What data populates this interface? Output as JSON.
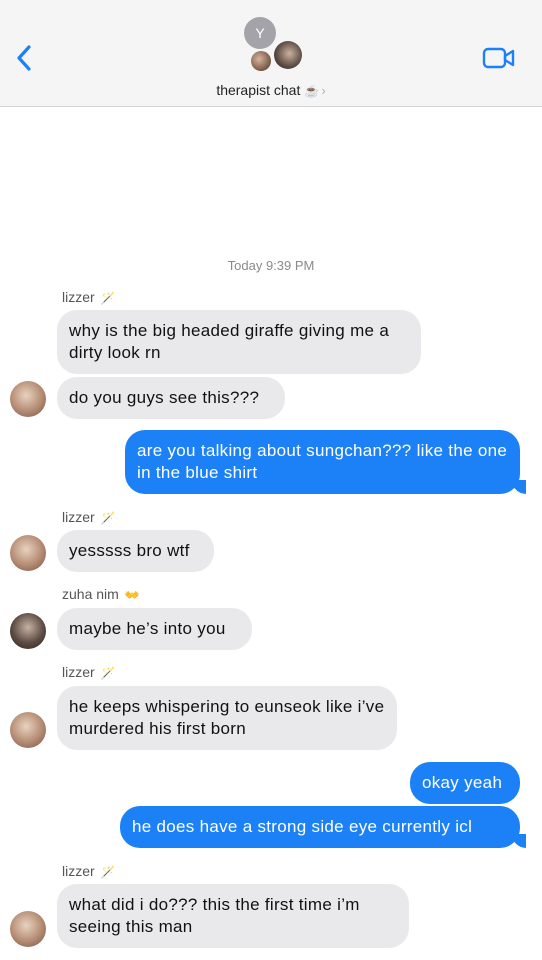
{
  "header": {
    "avatar_initial": "Y",
    "title": "therapist chat",
    "title_emoji": "☕",
    "chevron": "›"
  },
  "timestamp": "Today 9:39 PM",
  "messages": [
    {
      "type": "sender",
      "text": "lizzer",
      "emoji": "🪄"
    },
    {
      "type": "in",
      "text": "why is the big headed giraffe giving me a dirty look rn"
    },
    {
      "type": "in",
      "text": "do you guys see this???"
    },
    {
      "type": "out",
      "text": "are you talking about sungchan??? like the one in the blue shirt"
    },
    {
      "type": "sender",
      "text": "lizzer",
      "emoji": "🪄"
    },
    {
      "type": "in",
      "text": "yesssss bro wtf"
    },
    {
      "type": "sender",
      "text": "zuha nim",
      "emoji": "👐"
    },
    {
      "type": "in",
      "text": "maybe he’s into you"
    },
    {
      "type": "sender",
      "text": "lizzer",
      "emoji": "🪄"
    },
    {
      "type": "in",
      "text": "he keeps whispering to eunseok like i’ve murdered his first born"
    },
    {
      "type": "out",
      "text": "okay yeah"
    },
    {
      "type": "out",
      "text": "he does have a strong side eye currently icl"
    },
    {
      "type": "sender",
      "text": "lizzer",
      "emoji": "🪄"
    },
    {
      "type": "in",
      "text": "what did i do??? this the first time i’m seeing this man"
    }
  ],
  "colors": {
    "outgoing_bubble": "#1c81f7",
    "incoming_bubble": "#e9e9eb",
    "accent": "#1c81f7"
  },
  "icons": [
    "back-chevron-icon",
    "video-camera-icon"
  ]
}
